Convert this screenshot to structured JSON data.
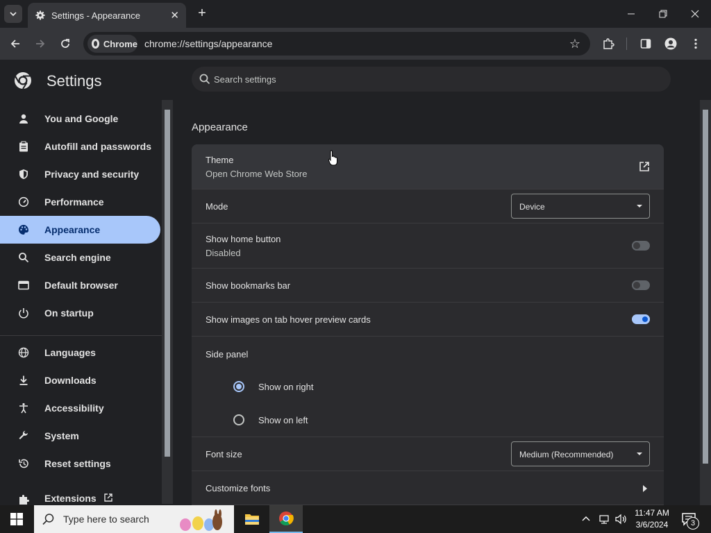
{
  "browser": {
    "tab_title": "Settings - Appearance",
    "new_tab_label": "+",
    "omnibox_chip": "Chrome",
    "url": "chrome://settings/appearance"
  },
  "settings": {
    "title": "Settings",
    "search_placeholder": "Search settings",
    "nav": [
      {
        "label": "You and Google",
        "icon": "person-icon"
      },
      {
        "label": "Autofill and passwords",
        "icon": "clipboard-icon"
      },
      {
        "label": "Privacy and security",
        "icon": "shield-icon"
      },
      {
        "label": "Performance",
        "icon": "speedometer-icon"
      },
      {
        "label": "Appearance",
        "icon": "palette-icon",
        "active": true
      },
      {
        "label": "Search engine",
        "icon": "search-icon"
      },
      {
        "label": "Default browser",
        "icon": "browser-icon"
      },
      {
        "label": "On startup",
        "icon": "power-icon"
      },
      {
        "label": "Languages",
        "icon": "globe-icon"
      },
      {
        "label": "Downloads",
        "icon": "download-icon"
      },
      {
        "label": "Accessibility",
        "icon": "accessibility-icon"
      },
      {
        "label": "System",
        "icon": "wrench-icon"
      },
      {
        "label": "Reset settings",
        "icon": "reset-icon"
      },
      {
        "label": "Extensions",
        "icon": "puzzle-icon"
      }
    ],
    "section_title": "Appearance",
    "theme": {
      "label": "Theme",
      "sub": "Open Chrome Web Store"
    },
    "mode": {
      "label": "Mode",
      "value": "Device"
    },
    "home_button": {
      "label": "Show home button",
      "sub": "Disabled",
      "enabled": false
    },
    "bookmarks_bar": {
      "label": "Show bookmarks bar",
      "enabled": false
    },
    "tab_hover": {
      "label": "Show images on tab hover preview cards",
      "enabled": true
    },
    "side_panel": {
      "label": "Side panel",
      "options": [
        {
          "label": "Show on right",
          "selected": true
        },
        {
          "label": "Show on left",
          "selected": false
        }
      ]
    },
    "font_size": {
      "label": "Font size",
      "value": "Medium (Recommended)"
    },
    "customize_fonts": {
      "label": "Customize fonts"
    }
  },
  "taskbar": {
    "search_placeholder": "Type here to search",
    "time": "11:47 AM",
    "date": "3/6/2024",
    "notification_count": "3"
  },
  "colors": {
    "accent": "#a8c7fa",
    "toggle_on": "#0b57d0",
    "background": "#202124"
  }
}
